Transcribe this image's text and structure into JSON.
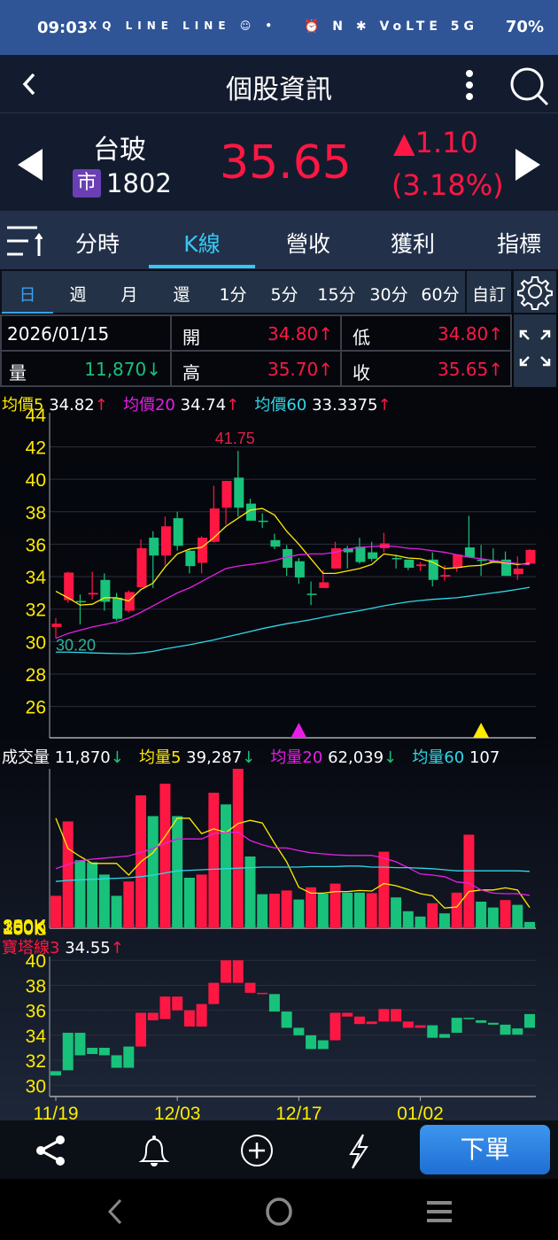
{
  "status": {
    "time": "09:03",
    "apps": "XQ LINE LINE ☺ •",
    "right_icons": "⏰ N ✱ VoLTE 5G",
    "battery": "70%"
  },
  "header": {
    "title": "個股資訊",
    "back_icon": "chevron-left",
    "menu_icon": "more-vertical",
    "search_icon": "search"
  },
  "quote": {
    "name": "台玻",
    "market_badge": "市",
    "code": "1802",
    "price": "35.65",
    "change": "▲1.10",
    "change_pct": "(3.18%)"
  },
  "tabs": [
    {
      "label": "分時"
    },
    {
      "label": "K線",
      "active": true
    },
    {
      "label": "營收"
    },
    {
      "label": "獲利"
    },
    {
      "label": "指標"
    }
  ],
  "periods": [
    "日",
    "週",
    "月",
    "還",
    "1分",
    "5分",
    "15分",
    "30分",
    "60分"
  ],
  "period_custom": "自訂",
  "info": {
    "date": "2026/01/15",
    "open_label": "開",
    "open": "34.80↑",
    "low_label": "低",
    "low": "34.80↑",
    "vol_label": "量",
    "vol": "11,870↓",
    "high_label": "高",
    "high": "35.70↑",
    "close_label": "收",
    "close": "35.65↑"
  },
  "ma_legend": [
    {
      "label": "均價5",
      "value": "34.82",
      "arrow": "↑",
      "color": "#ffeb00"
    },
    {
      "label": "均價20",
      "value": "34.74",
      "arrow": "↑",
      "color": "#e81ee8"
    },
    {
      "label": "均價60",
      "value": "33.3375",
      "arrow": "↑",
      "color": "#2fd8e8"
    }
  ],
  "vol_legend": [
    {
      "label": "成交量",
      "value": "11,870",
      "arrow": "↓",
      "color": "#ffffff"
    },
    {
      "label": "均量5",
      "value": "39,287",
      "arrow": "↓",
      "color": "#ffeb00"
    },
    {
      "label": "均量20",
      "value": "62,039",
      "arrow": "↓",
      "color": "#e81ee8"
    },
    {
      "label": "均量60",
      "value": "107",
      "arrow": "",
      "color": "#2fd8e8"
    }
  ],
  "tower_legend": {
    "label": "寶塔線3",
    "value": "34.55",
    "arrow": "↑"
  },
  "colors": {
    "up": "#ff1744",
    "down": "#18c27a",
    "axis": "#ffeb00"
  },
  "chart_data": [
    {
      "type": "candlestick",
      "title": "K線 日",
      "ylim": [
        24.07,
        44.1
      ],
      "yticks": [
        26,
        28,
        30,
        32,
        34,
        36,
        38,
        40,
        42,
        44
      ],
      "max_label": "41.75",
      "min_label": "30.20",
      "ohlc": [
        [
          30.9,
          31.45,
          30.2,
          31.1
        ],
        [
          32.55,
          34.3,
          32.4,
          34.25
        ],
        [
          32.5,
          32.9,
          31.05,
          32.45
        ],
        [
          32.9,
          34.3,
          32.6,
          33.0
        ],
        [
          33.8,
          34.2,
          31.9,
          32.45
        ],
        [
          32.7,
          33.0,
          31.3,
          31.4
        ],
        [
          31.9,
          33.15,
          31.8,
          33.05
        ],
        [
          33.35,
          36.3,
          33.3,
          35.75
        ],
        [
          36.4,
          36.8,
          33.3,
          35.3
        ],
        [
          35.3,
          37.7,
          34.7,
          37.1
        ],
        [
          37.6,
          38.0,
          35.6,
          35.9
        ],
        [
          35.6,
          35.7,
          34.2,
          34.65
        ],
        [
          34.85,
          36.5,
          34.2,
          36.4
        ],
        [
          36.15,
          39.6,
          36.1,
          38.2
        ],
        [
          38.25,
          39.9,
          37.2,
          39.9
        ],
        [
          40.1,
          41.75,
          37.7,
          38.25
        ],
        [
          38.5,
          38.8,
          37.45,
          37.45
        ],
        [
          37.45,
          37.9,
          37.0,
          37.4
        ],
        [
          36.25,
          36.65,
          35.7,
          35.85
        ],
        [
          35.7,
          35.95,
          34.05,
          34.55
        ],
        [
          34.95,
          35.15,
          33.55,
          33.95
        ],
        [
          32.95,
          33.7,
          32.25,
          32.9
        ],
        [
          33.3,
          34.4,
          33.3,
          33.65
        ],
        [
          34.5,
          36.15,
          34.5,
          35.75
        ],
        [
          35.75,
          35.9,
          34.5,
          35.5
        ],
        [
          35.85,
          36.4,
          34.8,
          34.9
        ],
        [
          35.5,
          36.15,
          34.95,
          35.1
        ],
        [
          35.75,
          36.7,
          35.5,
          36.05
        ],
        [
          35.15,
          35.35,
          34.5,
          35.1
        ],
        [
          35.05,
          35.05,
          34.4,
          34.55
        ],
        [
          34.65,
          34.9,
          34.35,
          34.75
        ],
        [
          35.05,
          35.5,
          33.4,
          33.8
        ],
        [
          34.0,
          34.7,
          33.75,
          34.1
        ],
        [
          34.55,
          35.35,
          34.3,
          35.35
        ],
        [
          35.8,
          37.75,
          35.2,
          35.2
        ],
        [
          35.05,
          35.95,
          34.05,
          35.0
        ],
        [
          35.0,
          35.75,
          34.9,
          34.9
        ],
        [
          35.05,
          35.55,
          34.05,
          34.05
        ],
        [
          34.15,
          35.25,
          33.8,
          34.5
        ],
        [
          34.8,
          35.7,
          34.8,
          35.65
        ]
      ],
      "ma5": [
        33.1,
        32.7,
        32.25,
        32.3,
        32.7,
        32.7,
        32.5,
        33.2,
        33.6,
        34.6,
        35.4,
        35.7,
        35.8,
        36.4,
        37.1,
        37.6,
        38.1,
        38.2,
        37.8,
        36.8,
        36.0,
        35.1,
        34.2,
        34.2,
        34.35,
        34.5,
        34.75,
        35.4,
        35.3,
        35.15,
        35.1,
        34.9,
        34.5,
        34.55,
        34.65,
        34.7,
        34.9,
        34.85,
        34.75,
        34.82
      ],
      "ma20": [
        30.2,
        30.5,
        30.7,
        30.9,
        31.05,
        31.2,
        31.45,
        31.8,
        32.2,
        32.6,
        33.0,
        33.3,
        33.7,
        34.1,
        34.5,
        34.65,
        34.75,
        34.85,
        35.0,
        35.2,
        35.35,
        35.4,
        35.4,
        35.5,
        35.7,
        35.8,
        35.85,
        35.9,
        35.85,
        35.75,
        35.7,
        35.6,
        35.5,
        35.35,
        35.2,
        35.1,
        35.0,
        34.9,
        34.8,
        34.74
      ],
      "ma60": [
        29.35,
        29.35,
        29.33,
        29.3,
        29.28,
        29.26,
        29.25,
        29.3,
        29.4,
        29.55,
        29.68,
        29.8,
        29.95,
        30.1,
        30.28,
        30.45,
        30.62,
        30.8,
        30.95,
        31.1,
        31.22,
        31.35,
        31.5,
        31.65,
        31.78,
        31.9,
        32.05,
        32.2,
        32.33,
        32.45,
        32.53,
        32.6,
        32.65,
        32.7,
        32.8,
        32.9,
        33.0,
        33.1,
        33.22,
        33.34
      ],
      "signals": [
        {
          "index": 20,
          "color": "#e81ee8"
        },
        {
          "index": 35,
          "color": "#ffeb00"
        }
      ]
    },
    {
      "type": "bar",
      "title": "成交量",
      "unit": "K",
      "ylim": [
        0,
        300
      ],
      "yticks": [
        "0",
        "50K",
        "100K",
        "150K",
        "200K",
        "250K",
        "300K"
      ],
      "values": [
        61,
        201,
        128,
        124,
        101,
        61,
        88,
        250,
        211,
        272,
        211,
        95,
        101,
        255,
        233,
        300,
        135,
        64,
        65,
        71,
        54,
        77,
        65,
        84,
        67,
        67,
        66,
        144,
        58,
        32,
        22,
        47,
        28,
        67,
        176,
        50,
        39,
        53,
        44,
        11.87
      ],
      "up": [
        1,
        1,
        0,
        0,
        0,
        0,
        1,
        1,
        0,
        1,
        0,
        0,
        1,
        1,
        0,
        1,
        0,
        0,
        1,
        1,
        0,
        1,
        0,
        1,
        0,
        0,
        1,
        1,
        0,
        0,
        0,
        1,
        0,
        1,
        1,
        0,
        0,
        1,
        0,
        0
      ],
      "ma5": [
        207,
        150,
        135,
        122,
        122,
        122,
        100,
        125,
        142,
        173,
        207,
        207,
        178,
        187,
        180,
        197,
        203,
        198,
        160,
        125,
        77,
        66,
        66,
        69,
        69,
        71,
        70,
        84,
        80,
        73,
        65,
        61,
        38,
        40,
        69,
        72,
        72,
        76,
        72,
        39
      ],
      "ma20": [
        112,
        120,
        127,
        130,
        132,
        134,
        136,
        143,
        150,
        160,
        168,
        168,
        168,
        178,
        180,
        181,
        165,
        157,
        151,
        151,
        146,
        142,
        140,
        138,
        137,
        137,
        137,
        132,
        125,
        114,
        102,
        100,
        97,
        87,
        85,
        72,
        66,
        65,
        65,
        62
      ],
      "ma60": [
        88,
        90,
        91,
        92,
        93,
        94,
        95,
        97,
        100,
        104,
        108,
        109,
        110,
        111,
        112,
        113,
        114,
        115,
        115,
        115,
        115,
        116,
        116,
        116,
        117,
        117,
        115,
        115,
        114,
        114,
        113,
        112,
        110,
        108,
        108,
        108,
        108,
        108,
        108,
        107
      ]
    },
    {
      "type": "tower",
      "title": "寶塔線3",
      "ylim": [
        29.1,
        40.3
      ],
      "yticks": [
        30,
        32,
        34,
        36,
        38,
        40
      ],
      "blocks": [
        [
          31.13,
          30.78,
          0
        ],
        [
          34.2,
          31.2,
          0
        ],
        [
          34.2,
          32.4,
          0
        ],
        [
          33.0,
          32.5,
          0
        ],
        [
          33.0,
          32.4,
          0
        ],
        [
          32.4,
          31.4,
          0
        ],
        [
          33.1,
          31.4,
          0
        ],
        [
          35.8,
          33.1,
          1
        ],
        [
          35.8,
          35.2,
          1
        ],
        [
          37.1,
          35.3,
          1
        ],
        [
          37.1,
          36.0,
          1
        ],
        [
          36.0,
          34.7,
          1
        ],
        [
          36.5,
          34.7,
          1
        ],
        [
          38.2,
          36.5,
          1
        ],
        [
          40.0,
          38.2,
          1
        ],
        [
          40.0,
          38.2,
          1
        ],
        [
          38.2,
          37.4,
          1
        ],
        [
          37.4,
          37.3,
          1
        ],
        [
          37.3,
          35.9,
          0
        ],
        [
          35.9,
          34.6,
          0
        ],
        [
          34.6,
          34.0,
          0
        ],
        [
          34.0,
          32.9,
          0
        ],
        [
          33.6,
          32.9,
          0
        ],
        [
          35.8,
          33.6,
          1
        ],
        [
          35.8,
          35.5,
          1
        ],
        [
          35.5,
          34.9,
          1
        ],
        [
          35.1,
          34.9,
          1
        ],
        [
          36.1,
          35.1,
          1
        ],
        [
          36.1,
          35.1,
          1
        ],
        [
          35.1,
          34.6,
          1
        ],
        [
          34.8,
          34.6,
          1
        ],
        [
          34.8,
          33.8,
          0
        ],
        [
          34.1,
          33.8,
          0
        ],
        [
          35.4,
          34.2,
          0
        ],
        [
          35.4,
          35.3,
          0
        ],
        [
          35.2,
          35.0,
          0
        ],
        [
          35.0,
          34.85,
          0
        ],
        [
          34.85,
          34.05,
          0
        ],
        [
          34.55,
          34.05,
          0
        ],
        [
          35.7,
          34.6,
          0
        ]
      ],
      "xlabels": [
        {
          "index": 0,
          "label": "11/19"
        },
        {
          "index": 10,
          "label": "12/03"
        },
        {
          "index": 20,
          "label": "12/17"
        },
        {
          "index": 30,
          "label": "01/02"
        }
      ]
    }
  ],
  "toolbar": {
    "order_label": "下單"
  }
}
